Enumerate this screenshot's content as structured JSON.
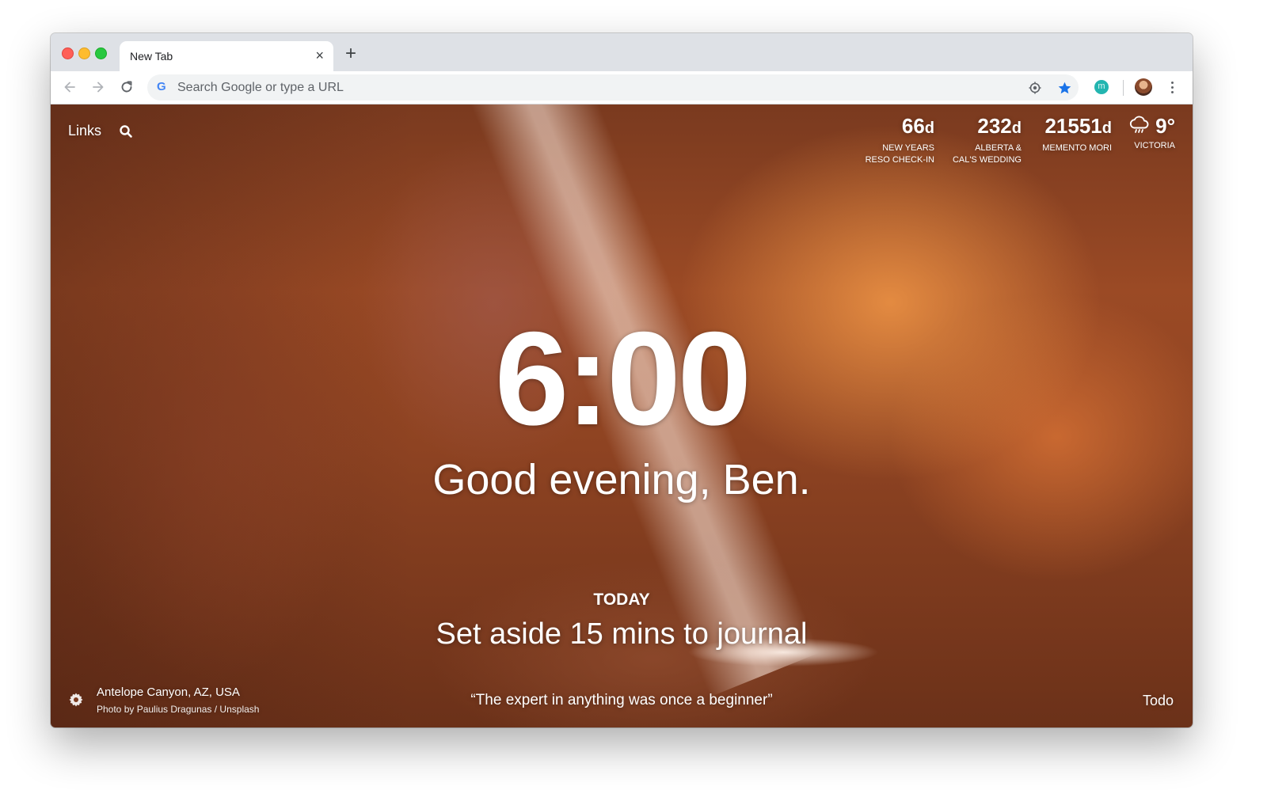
{
  "browser": {
    "tab_title": "New Tab",
    "tab_close_glyph": "×",
    "new_tab_glyph": "+",
    "omnibox_placeholder": "Search Google or type a URL",
    "google_glyph": "G",
    "extension_glyph": "m",
    "icons": [
      "back-arrow-icon",
      "forward-arrow-icon",
      "reload-icon",
      "location-icon",
      "bookmark-star-icon",
      "extension-icon",
      "avatar",
      "kebab-menu-icon"
    ],
    "colors": {
      "tabstrip": "#dee1e6",
      "omnibox": "#f1f3f4",
      "star": "#1a73e8"
    }
  },
  "momentum": {
    "links_label": "Links",
    "metrics": [
      {
        "value": "66",
        "unit": "d",
        "label_line1": "NEW YEARS",
        "label_line2": "RESO CHECK-IN"
      },
      {
        "value": "232",
        "unit": "d",
        "label_line1": "ALBERTA &",
        "label_line2": "CAL'S WEDDING"
      },
      {
        "value": "21551",
        "unit": "d",
        "label_line1": "MEMENTO MORI",
        "label_line2": ""
      }
    ],
    "weather": {
      "temperature": "9°",
      "location": "VICTORIA",
      "icon": "cloud-rain-icon"
    },
    "clock": "6:00",
    "greeting": "Good evening, Ben.",
    "focus_label": "TODAY",
    "focus_text": "Set aside 15 mins to journal",
    "photo_location": "Antelope Canyon, AZ, USA",
    "photo_credit": "Photo by Paulius Dragunas / Unsplash",
    "quote": "“The expert in anything was once a beginner”",
    "todo_label": "Todo"
  }
}
